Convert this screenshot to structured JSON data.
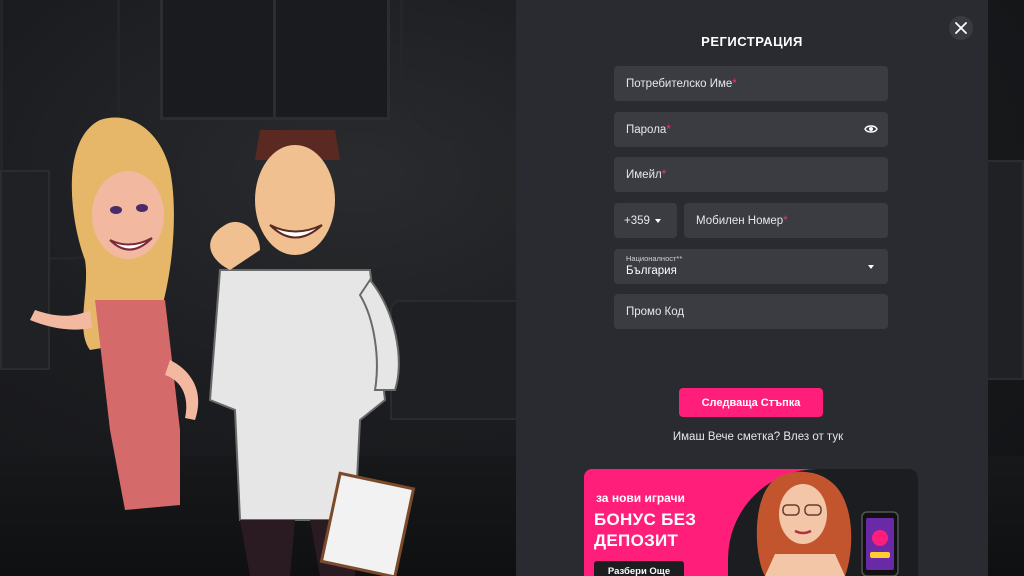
{
  "modal": {
    "title": "РЕГИСТРАЦИЯ",
    "fields": {
      "username": {
        "label": "Потребителско Име",
        "required_mark": "*"
      },
      "password": {
        "label": "Парола",
        "required_mark": "*"
      },
      "email": {
        "label": "Имейл",
        "required_mark": "*"
      },
      "country_code": {
        "value": "+359"
      },
      "phone": {
        "label": "Мобилен Номер",
        "required_mark": "*"
      },
      "nationality": {
        "label": "Националност**",
        "value": "България"
      },
      "promo": {
        "label": "Промо Код"
      }
    },
    "next_button": "Следваща Стъпка",
    "login_prompt": "Имаш Вече сметка? Влез от тук"
  },
  "banner": {
    "small_text": "за нови играчи",
    "big_line1": "БОНУС БЕЗ",
    "big_line2": "ДЕПОЗИТ",
    "button": "Разбери Още"
  },
  "colors": {
    "accent": "#ff1f7a",
    "panel": "#2a2b30",
    "field": "#3b3c42"
  },
  "icons": {
    "close": "close-icon",
    "password_visibility": "eye-icon",
    "dropdown": "chevron-down-icon"
  }
}
